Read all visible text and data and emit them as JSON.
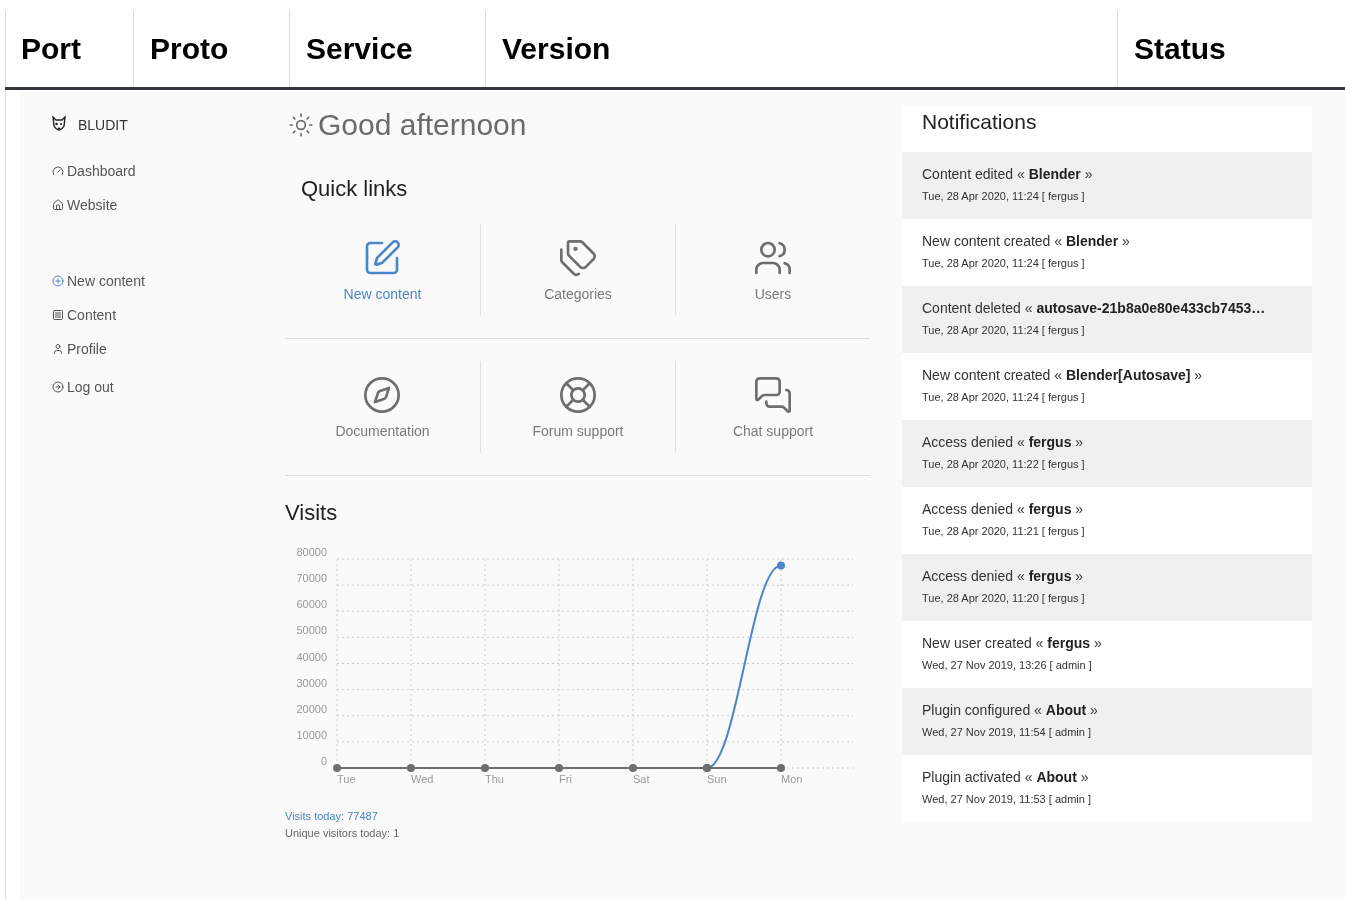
{
  "table": {
    "columns": [
      "Port",
      "Proto",
      "Service",
      "Version",
      "Status"
    ]
  },
  "sidebar": {
    "brand": "BLUDIT",
    "groups": [
      [
        {
          "label": "Dashboard",
          "kind": "gauge"
        },
        {
          "label": "Website",
          "kind": "home"
        }
      ],
      [
        {
          "label": "New content",
          "kind": "plus"
        },
        {
          "label": "Content",
          "kind": "archive"
        },
        {
          "label": "Profile",
          "kind": "user"
        }
      ],
      [
        {
          "label": "Log out",
          "kind": "logout"
        }
      ]
    ]
  },
  "greeting": "Good afternoon",
  "quick_links": {
    "title": "Quick links",
    "rows": [
      [
        {
          "label": "New content",
          "kind": "edit",
          "selected": true
        },
        {
          "label": "Categories",
          "kind": "tags",
          "selected": false
        },
        {
          "label": "Users",
          "kind": "users",
          "selected": false
        }
      ],
      [
        {
          "label": "Documentation",
          "kind": "compass",
          "selected": false
        },
        {
          "label": "Forum support",
          "kind": "lifebuoy",
          "selected": false
        },
        {
          "label": "Chat support",
          "kind": "chat",
          "selected": false
        }
      ]
    ]
  },
  "visits": {
    "title": "Visits",
    "chart_data": {
      "type": "line",
      "grid": true,
      "categories": [
        "Tue",
        "Wed",
        "Thu",
        "Fri",
        "Sat",
        "Sun",
        "Mon"
      ],
      "ylim": [
        0,
        80000
      ],
      "yticks": [
        0,
        10000,
        20000,
        30000,
        40000,
        50000,
        60000,
        70000,
        80000
      ],
      "series": [
        {
          "color": "#4a86c8",
          "marker": true,
          "values": [
            null,
            null,
            null,
            null,
            null,
            0,
            77500
          ]
        },
        {
          "color": "#6e6e6e",
          "marker": true,
          "values": [
            0,
            0,
            0,
            0,
            0,
            0,
            0
          ]
        }
      ]
    },
    "visits_today": "Visits today: 77487",
    "unique_today": "Unique visitors today: 1"
  },
  "notifications": {
    "title": "Notifications",
    "items": [
      {
        "text": "Content edited « **Blender** »",
        "meta": "Tue, 28 Apr 2020, 11:24 [ fergus ]"
      },
      {
        "text": "New content created « **Blender** »",
        "meta": "Tue, 28 Apr 2020, 11:24 [ fergus ]"
      },
      {
        "text": "Content deleted « **autosave-21b8a0e80e433cb7453…**",
        "meta": "Tue, 28 Apr 2020, 11:24 [ fergus ]"
      },
      {
        "text": "New content created « **Blender[Autosave]** »",
        "meta": "Tue, 28 Apr 2020, 11:24 [ fergus ]"
      },
      {
        "text": "Access denied « **fergus** »",
        "meta": "Tue, 28 Apr 2020, 11:22 [ fergus ]"
      },
      {
        "text": "Access denied « **fergus** »",
        "meta": "Tue, 28 Apr 2020, 11:21 [ fergus ]"
      },
      {
        "text": "Access denied « **fergus** »",
        "meta": "Tue, 28 Apr 2020, 11:20 [ fergus ]"
      },
      {
        "text": "New user created « **fergus** »",
        "meta": "Wed, 27 Nov 2019, 13:26 [ admin ]"
      },
      {
        "text": "Plugin configured « **About** »",
        "meta": "Wed, 27 Nov 2019, 11:54 [ admin ]"
      },
      {
        "text": "Plugin activated « **About** »",
        "meta": "Wed, 27 Nov 2019, 11:53 [ admin ]"
      }
    ]
  }
}
